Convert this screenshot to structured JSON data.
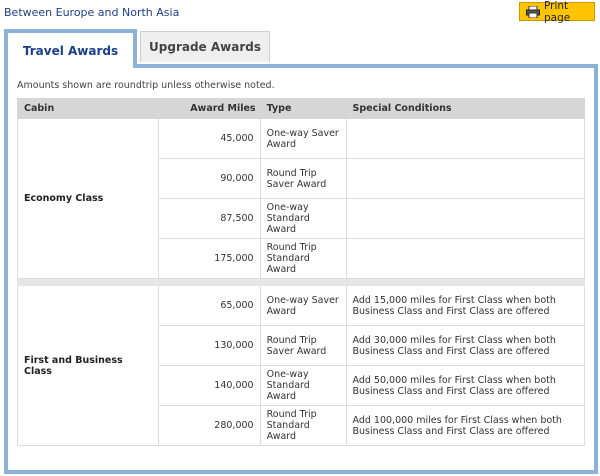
{
  "header": {
    "title": "Between Europe and North Asia",
    "print_label": "Print page"
  },
  "tabs": [
    {
      "label": "Travel Awards",
      "active": true
    },
    {
      "label": "Upgrade Awards",
      "active": false
    }
  ],
  "note": "Amounts shown are roundtrip unless otherwise noted.",
  "table": {
    "columns": [
      "Cabin",
      "Award Miles",
      "Type",
      "Special Conditions"
    ],
    "groups": [
      {
        "cabin": "Economy Class",
        "rows": [
          {
            "miles": "45,000",
            "type": "One-way Saver Award",
            "conditions": ""
          },
          {
            "miles": "90,000",
            "type": "Round Trip Saver Award",
            "conditions": ""
          },
          {
            "miles": "87,500",
            "type": "One-way Standard Award",
            "conditions": ""
          },
          {
            "miles": "175,000",
            "type": "Round Trip Standard Award",
            "conditions": ""
          }
        ]
      },
      {
        "cabin": "First and Business Class",
        "rows": [
          {
            "miles": "65,000",
            "type": "One-way Saver Award",
            "conditions": "Add 15,000 miles for First Class when both Business Class and First Class are offered"
          },
          {
            "miles": "130,000",
            "type": "Round Trip Saver Award",
            "conditions": "Add 30,000 miles for First Class when both Business Class and First Class are offered"
          },
          {
            "miles": "140,000",
            "type": "One-way Standard Award",
            "conditions": "Add 50,000 miles for First Class when both Business Class and First Class are offered"
          },
          {
            "miles": "280,000",
            "type": "Round Trip Standard Award",
            "conditions": "Add 100,000 miles for First Class when both Business Class and First Class are offered"
          }
        ]
      }
    ]
  },
  "icons": {
    "print": "printer-icon"
  },
  "colors": {
    "accent": "#8cb2d8",
    "button": "#ffc400",
    "title": "#1d3f87"
  }
}
